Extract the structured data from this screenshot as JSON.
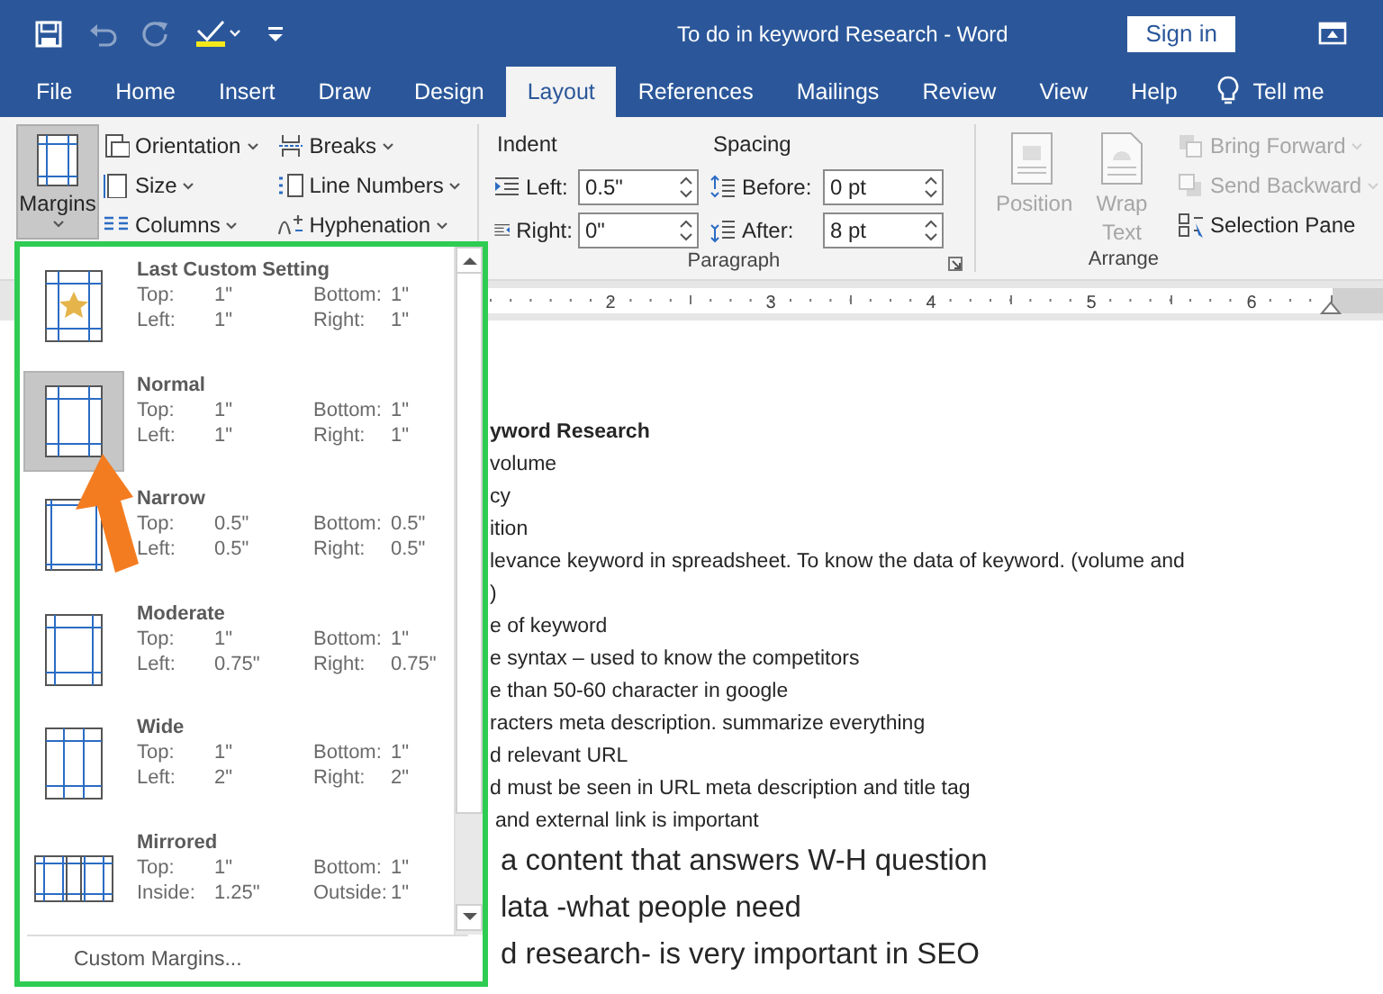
{
  "window": {
    "title": "To do in keyword Research  -  Word"
  },
  "quick_access": [
    {
      "kind": "save",
      "disabled": false
    },
    {
      "kind": "undo",
      "disabled": true
    },
    {
      "kind": "redo",
      "disabled": true
    },
    {
      "kind": "spelling",
      "disabled": false
    },
    {
      "kind": "customize",
      "disabled": false
    }
  ],
  "account": {
    "sign_in": "Sign in"
  },
  "tabs": [
    {
      "label": "File",
      "selected": false
    },
    {
      "label": "Home",
      "selected": false
    },
    {
      "label": "Insert",
      "selected": false
    },
    {
      "label": "Draw",
      "selected": false
    },
    {
      "label": "Design",
      "selected": false
    },
    {
      "label": "Layout",
      "selected": true
    },
    {
      "label": "References",
      "selected": false
    },
    {
      "label": "Mailings",
      "selected": false
    },
    {
      "label": "Review",
      "selected": false
    },
    {
      "label": "View",
      "selected": false
    },
    {
      "label": "Help",
      "selected": false
    }
  ],
  "tell_me": "Tell me",
  "ribbon": {
    "page_setup": {
      "margins": {
        "label": "Margins",
        "expanded": true
      },
      "commands": [
        {
          "label": "Orientation"
        },
        {
          "label": "Size"
        },
        {
          "label": "Columns"
        },
        {
          "label": "Breaks"
        },
        {
          "label": "Line Numbers"
        },
        {
          "label": "Hyphenation"
        }
      ]
    },
    "paragraph": {
      "title": "Paragraph",
      "indent": {
        "heading": "Indent",
        "fields": [
          {
            "label": "Left:",
            "value": "0.5\""
          },
          {
            "label": "Right:",
            "value": "0\""
          }
        ]
      },
      "spacing": {
        "heading": "Spacing",
        "fields": [
          {
            "label": "Before:",
            "value": "0 pt"
          },
          {
            "label": "After:",
            "value": "8 pt"
          }
        ]
      }
    },
    "arrange": {
      "title": "Arrange",
      "large": [
        {
          "label": "Position",
          "disabled": true
        },
        {
          "label": "Wrap Text",
          "disabled": true
        }
      ],
      "small": [
        {
          "label": "Bring Forward",
          "disabled": true
        },
        {
          "label": "Send Backward",
          "disabled": true
        },
        {
          "label": "Selection Pane",
          "disabled": false
        }
      ]
    }
  },
  "ruler": {
    "numbers": [
      "2",
      "3",
      "4",
      "5",
      "6"
    ]
  },
  "document": {
    "lines": [
      {
        "kind": "heading",
        "text": "yword Research"
      },
      {
        "kind": "normal",
        "text": "volume"
      },
      {
        "kind": "normal",
        "text": "cy"
      },
      {
        "kind": "normal",
        "text": "ition"
      },
      {
        "kind": "normal",
        "text": "levance keyword in spreadsheet. To know the data of keyword. (volume and"
      },
      {
        "kind": "normal",
        "text": ")"
      },
      {
        "kind": "normal",
        "text": "e of keyword"
      },
      {
        "kind": "normal",
        "text": "e syntax – used to know the competitors"
      },
      {
        "kind": "normal",
        "text": "e than 50-60 character in google"
      },
      {
        "kind": "normal",
        "text": "racters meta description. summarize everything"
      },
      {
        "kind": "normal",
        "text": "d relevant URL"
      },
      {
        "kind": "normal",
        "text": "d must be seen in URL meta description and title tag"
      },
      {
        "kind": "normal",
        "text": "and external link is important"
      },
      {
        "kind": "large",
        "text": "a content that answers W-H question"
      },
      {
        "kind": "large",
        "text": "lata -what people need"
      },
      {
        "kind": "large",
        "text": "d research- is very important in SEO"
      }
    ]
  },
  "margins_menu": {
    "items": [
      {
        "kind": "custom",
        "name": "Last Custom Setting",
        "selected": false,
        "fields": [
          {
            "label": "Top:",
            "value": "1\""
          },
          {
            "label": "Bottom:",
            "value": "1\""
          },
          {
            "label": "Left:",
            "value": "1\""
          },
          {
            "label": "Right:",
            "value": "1\""
          }
        ]
      },
      {
        "kind": "normal",
        "name": "Normal",
        "selected": true,
        "fields": [
          {
            "label": "Top:",
            "value": "1\""
          },
          {
            "label": "Bottom:",
            "value": "1\""
          },
          {
            "label": "Left:",
            "value": "1\""
          },
          {
            "label": "Right:",
            "value": "1\""
          }
        ]
      },
      {
        "kind": "narrow",
        "name": "Narrow",
        "selected": false,
        "fields": [
          {
            "label": "Top:",
            "value": "0.5\""
          },
          {
            "label": "Bottom:",
            "value": "0.5\""
          },
          {
            "label": "Left:",
            "value": "0.5\""
          },
          {
            "label": "Right:",
            "value": "0.5\""
          }
        ]
      },
      {
        "kind": "moderate",
        "name": "Moderate",
        "selected": false,
        "fields": [
          {
            "label": "Top:",
            "value": "1\""
          },
          {
            "label": "Bottom:",
            "value": "1\""
          },
          {
            "label": "Left:",
            "value": "0.75\""
          },
          {
            "label": "Right:",
            "value": "0.75\""
          }
        ]
      },
      {
        "kind": "wide",
        "name": "Wide",
        "selected": false,
        "fields": [
          {
            "label": "Top:",
            "value": "1\""
          },
          {
            "label": "Bottom:",
            "value": "1\""
          },
          {
            "label": "Left:",
            "value": "2\""
          },
          {
            "label": "Right:",
            "value": "2\""
          }
        ]
      },
      {
        "kind": "mirrored",
        "name": "Mirrored",
        "selected": false,
        "fields": [
          {
            "label": "Top:",
            "value": "1\""
          },
          {
            "label": "Bottom:",
            "value": "1\""
          },
          {
            "label": "Inside:",
            "value": "1.25\""
          },
          {
            "label": "Outside:",
            "value": "1\""
          }
        ]
      }
    ],
    "footer": "Custom Margins..."
  }
}
